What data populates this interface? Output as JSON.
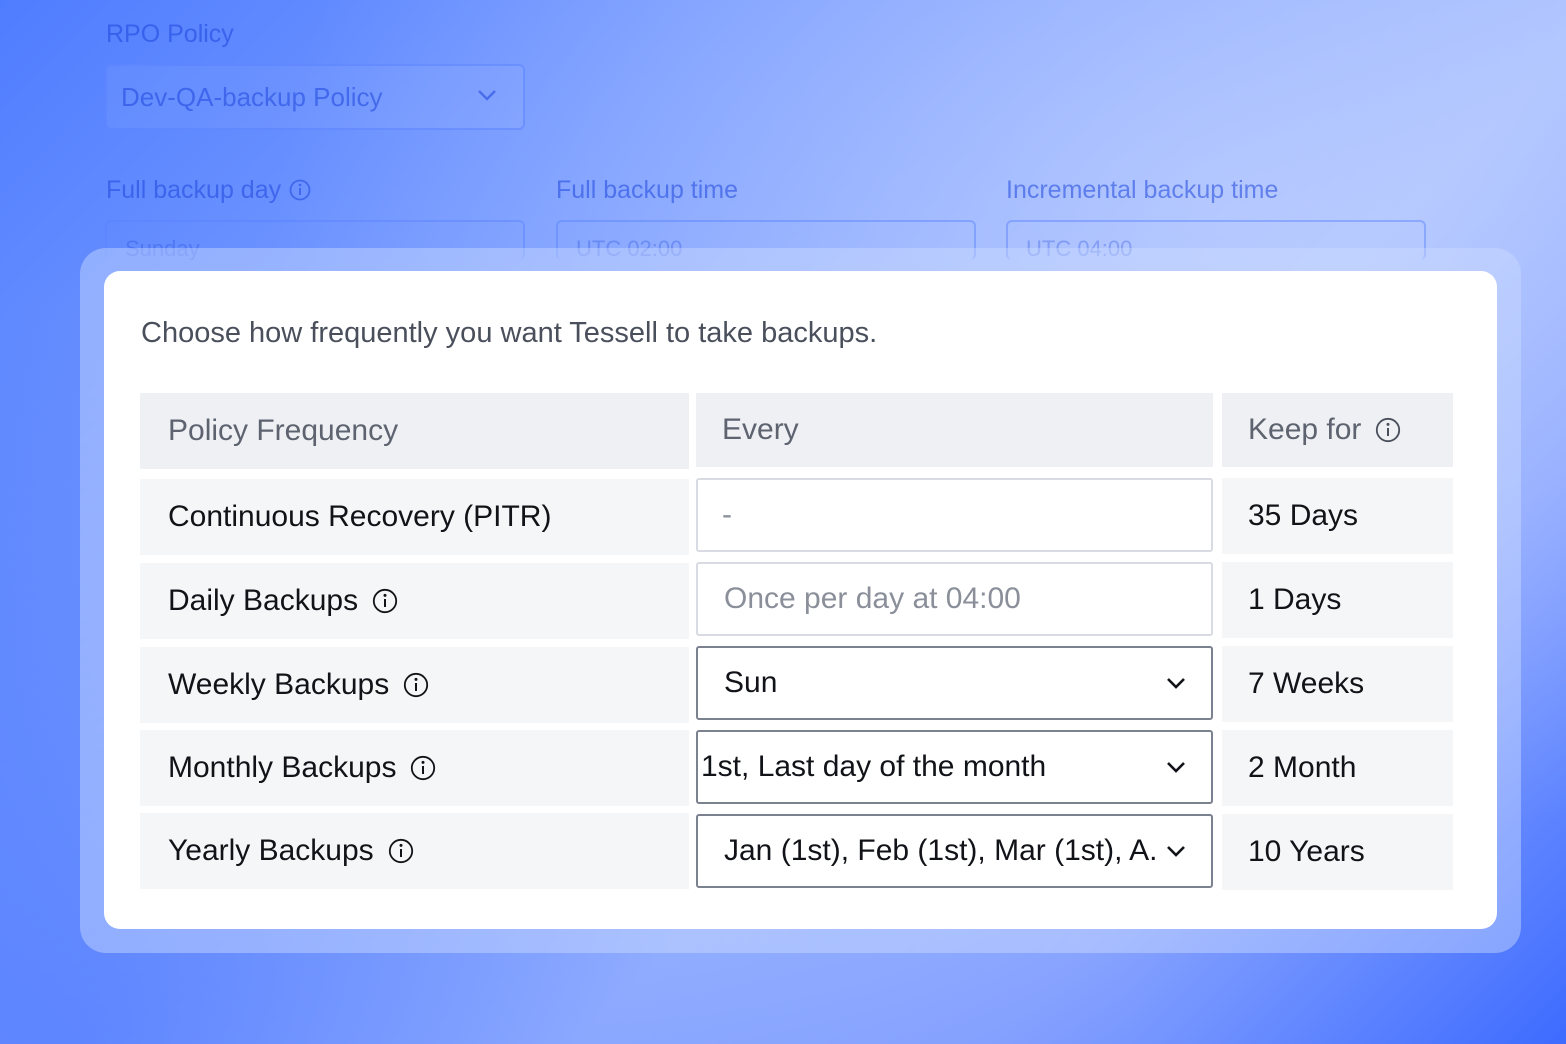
{
  "background": {
    "rpo_label": "RPO Policy",
    "rpo_value": "Dev-QA-backup Policy",
    "full_day_label": "Full backup day",
    "full_day_value": "Sunday",
    "full_time_label": "Full backup time",
    "full_time_value": "UTC 02:00",
    "incr_time_label": "Incremental backup time",
    "incr_time_value": "UTC 04:00"
  },
  "modal": {
    "intro": "Choose how frequently you want Tessell to take backups.",
    "headers": {
      "frequency": "Policy Frequency",
      "every": "Every",
      "keep_for": "Keep for"
    },
    "rows": [
      {
        "frequency": "Continuous Recovery (PITR)",
        "every": "-",
        "keep_for": "35 Days"
      },
      {
        "frequency": "Daily Backups",
        "every": "Once per day at 04:00",
        "keep_for": "1 Days"
      },
      {
        "frequency": "Weekly Backups",
        "every": "Sun",
        "keep_for": "7 Weeks"
      },
      {
        "frequency": "Monthly Backups",
        "every": "1st, Last day of the month",
        "keep_for": "2 Month"
      },
      {
        "frequency": "Yearly Backups",
        "every": "Jan (1st), Feb (1st), Mar (1st), A...",
        "keep_for": "10 Years"
      }
    ]
  },
  "icons": {
    "info": "info-circle-icon",
    "dropdown": "chevron-down-icon"
  },
  "colors": {
    "accent_blue": "#3d6bff",
    "text_dark": "#111318",
    "header_text": "#5e6370"
  }
}
